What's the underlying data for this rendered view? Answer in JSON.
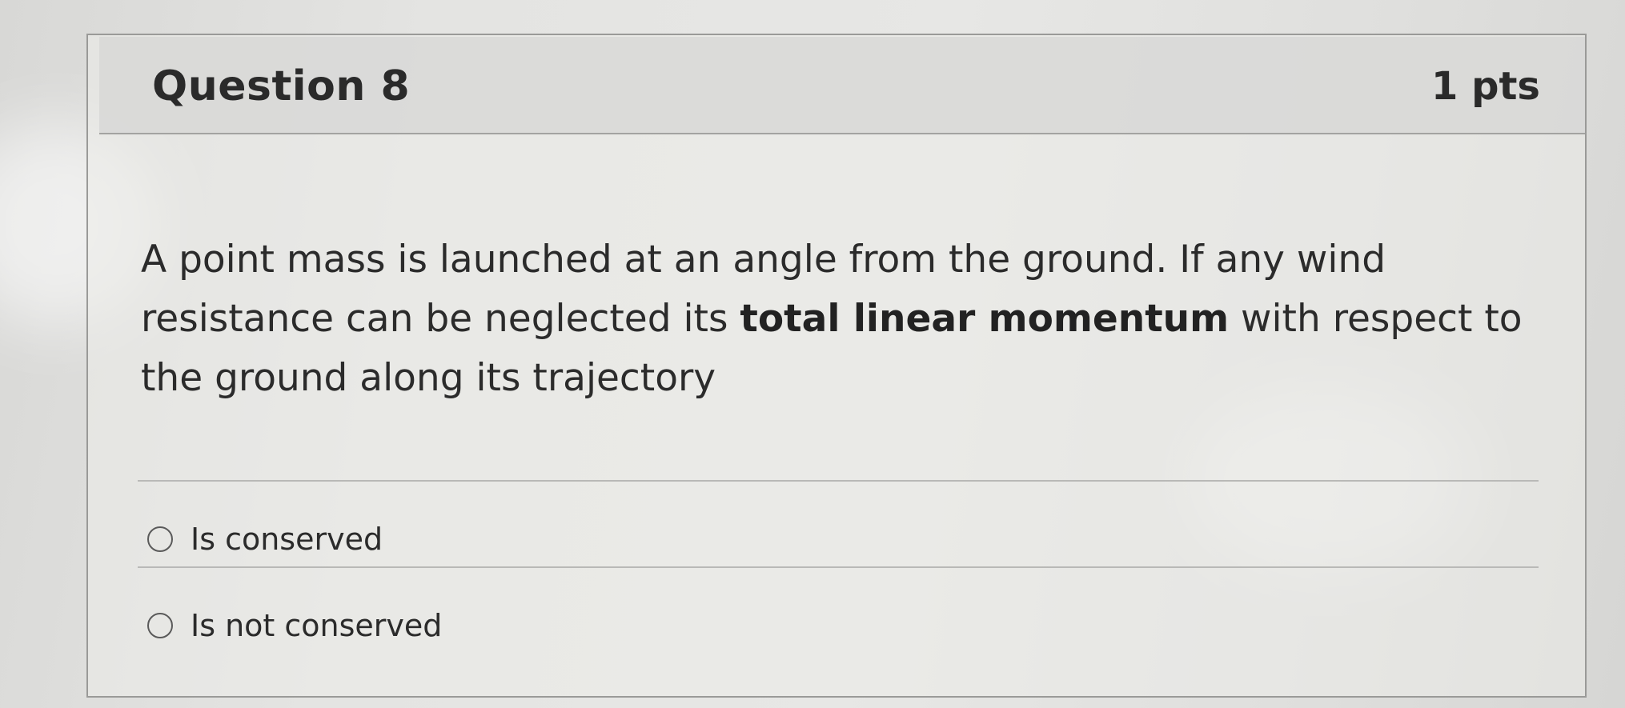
{
  "question": {
    "title": "Question 8",
    "points": "1 pts",
    "text_part1": "A point mass is launched at an angle from the ground. If any wind resistance can be neglected its ",
    "text_bold": "total linear momentum",
    "text_part2": " with respect to the ground along its trajectory"
  },
  "answers": [
    {
      "label": "Is conserved",
      "selected": false
    },
    {
      "label": "Is not conserved",
      "selected": false
    }
  ],
  "colors": {
    "border": "#9a9a98",
    "header_background": "#d6d6d4",
    "text": "#2b2b2b"
  }
}
